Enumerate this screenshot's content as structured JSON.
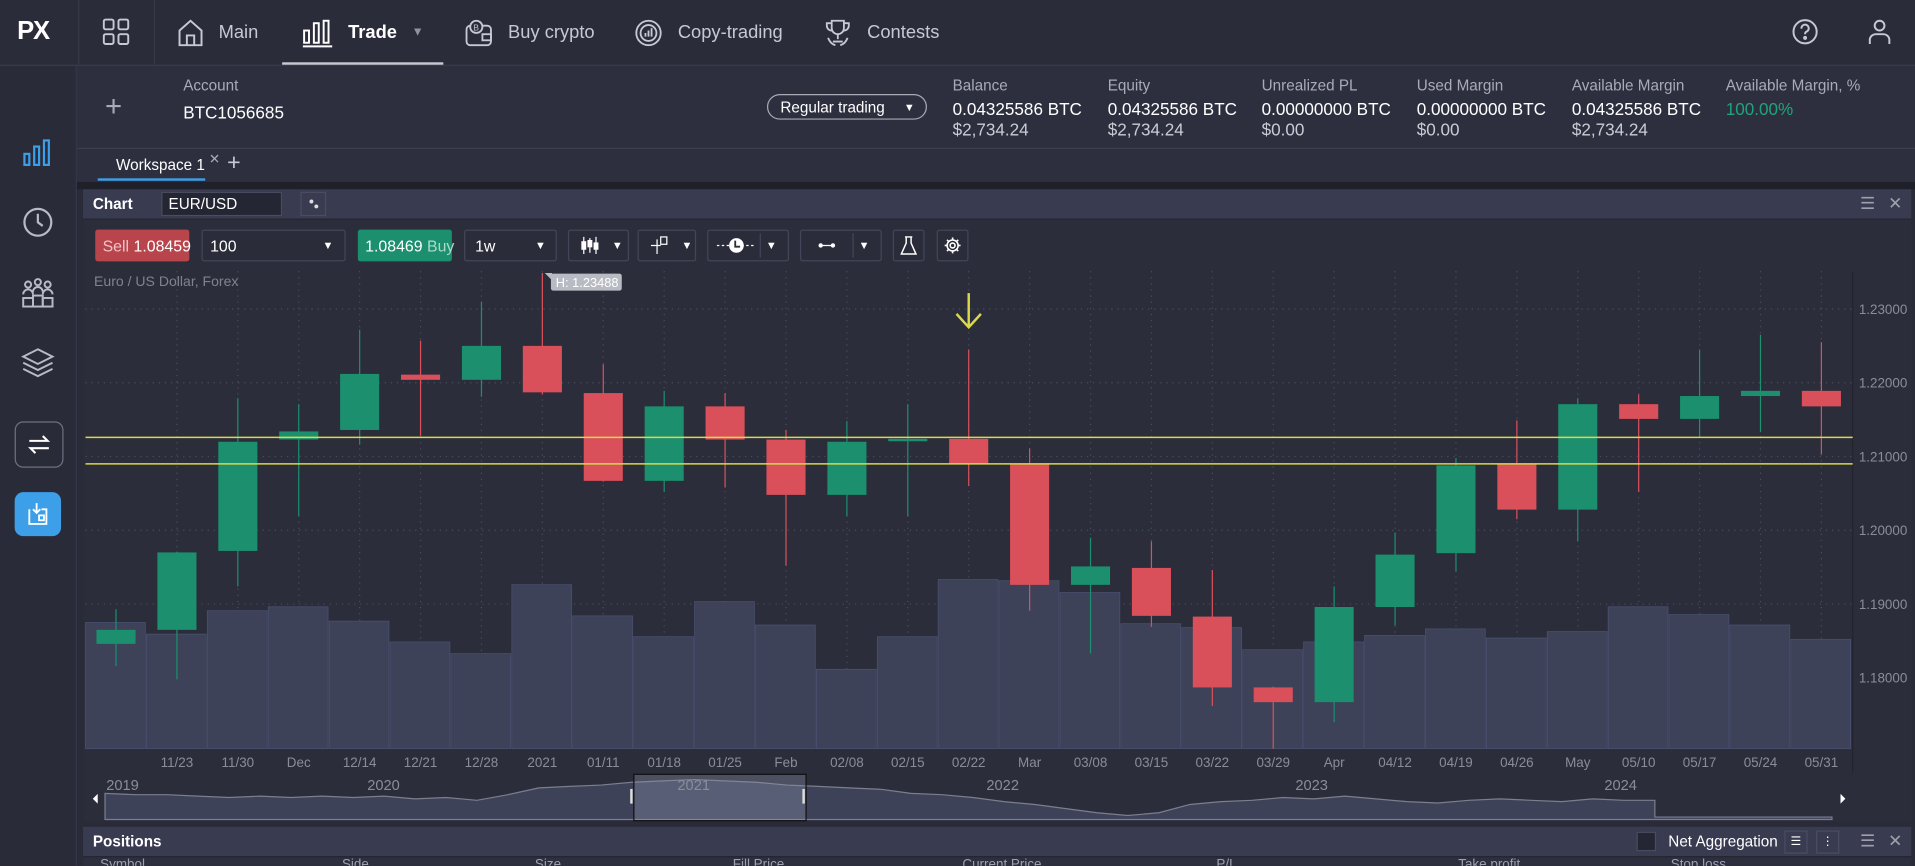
{
  "app": {
    "logo": "PX"
  },
  "nav": {
    "items": [
      {
        "label": "Main",
        "icon": "home-icon"
      },
      {
        "label": "Trade",
        "icon": "bar-chart-icon",
        "active": true
      },
      {
        "label": "Buy crypto",
        "icon": "wallet-bitcoin-icon"
      },
      {
        "label": "Copy-trading",
        "icon": "copy-trading-icon"
      },
      {
        "label": "Contests",
        "icon": "trophy-icon"
      }
    ]
  },
  "account": {
    "label": "Account",
    "id": "BTC1056685",
    "mode": "Regular trading",
    "metrics": [
      {
        "label": "Balance",
        "btc": "0.04325586 BTC",
        "usd": "$2,734.24"
      },
      {
        "label": "Equity",
        "btc": "0.04325586 BTC",
        "usd": "$2,734.24"
      },
      {
        "label": "Unrealized PL",
        "btc": "0.00000000 BTC",
        "usd": "$0.00"
      },
      {
        "label": "Used Margin",
        "btc": "0.00000000 BTC",
        "usd": "$0.00"
      },
      {
        "label": "Available Margin",
        "btc": "0.04325586 BTC",
        "usd": "$2,734.24"
      },
      {
        "label": "Available Margin, %",
        "btc": "100.00%",
        "usd": ""
      }
    ]
  },
  "workspace": {
    "tab": "Workspace 1"
  },
  "chart_panel": {
    "title": "Chart",
    "symbol": "EUR/USD",
    "sell_label": "Sell",
    "sell_price": "1.08459",
    "quantity": "100",
    "buy_price": "1.08469",
    "buy_label": "Buy",
    "timeframe": "1w",
    "instrument_desc": "Euro / US Dollar, Forex",
    "high_marker": "H: 1.23488"
  },
  "colors": {
    "up": "#1b8f6e",
    "down": "#d9505a",
    "level_line": "#d9d94a",
    "accent": "#3d9fe8",
    "positive_text": "#1fa37a"
  },
  "chart_data": {
    "type": "candlestick",
    "title": "",
    "ylim": [
      1.1675,
      1.2365
    ],
    "yticks": [
      "1.23000",
      "1.22000",
      "1.21000",
      "1.20000",
      "1.19000",
      "1.18000"
    ],
    "ytick_values": [
      1.23,
      1.22,
      1.21,
      1.2,
      1.19,
      1.18
    ],
    "grid": true,
    "categories": [
      "",
      "11/23",
      "11/30",
      "Dec",
      "12/14",
      "12/21",
      "12/28",
      "2021",
      "01/11",
      "01/18",
      "01/25",
      "Feb",
      "02/08",
      "02/15",
      "02/22",
      "Mar",
      "03/08",
      "03/15",
      "03/22",
      "03/29",
      "Apr",
      "04/12",
      "04/19",
      "04/26",
      "May",
      "05/10",
      "05/17",
      "05/24",
      "05/31"
    ],
    "ohlc": [
      [
        1.1846,
        1.1893,
        1.1816,
        1.1865
      ],
      [
        1.1865,
        1.1971,
        1.1798,
        1.197
      ],
      [
        1.1972,
        1.2179,
        1.1924,
        1.212
      ],
      [
        1.2123,
        1.2171,
        1.2019,
        1.2134
      ],
      [
        1.2136,
        1.2272,
        1.2116,
        1.2212
      ],
      [
        1.2211,
        1.2257,
        1.2128,
        1.2204
      ],
      [
        1.2204,
        1.231,
        1.2181,
        1.225
      ],
      [
        1.225,
        1.23488,
        1.2184,
        1.2187
      ],
      [
        1.2186,
        1.2225,
        1.2066,
        1.2067
      ],
      [
        1.2067,
        1.2189,
        1.2052,
        1.2168
      ],
      [
        1.2168,
        1.2186,
        1.2058,
        1.2123
      ],
      [
        1.2123,
        1.2136,
        1.1952,
        1.2048
      ],
      [
        1.2048,
        1.2148,
        1.2019,
        1.212
      ],
      [
        1.2121,
        1.2171,
        1.2019,
        1.2124
      ],
      [
        1.2124,
        1.2245,
        1.206,
        1.209
      ],
      [
        1.209,
        1.2111,
        1.1891,
        1.1926
      ],
      [
        1.1926,
        1.199,
        1.1833,
        1.1951
      ],
      [
        1.1949,
        1.1985,
        1.1869,
        1.1884
      ],
      [
        1.1883,
        1.1946,
        1.1762,
        1.1787
      ],
      [
        1.1787,
        1.1788,
        1.1704,
        1.1767
      ],
      [
        1.1767,
        1.1924,
        1.174,
        1.1896
      ],
      [
        1.1896,
        1.1997,
        1.1871,
        1.1967
      ],
      [
        1.1969,
        1.2098,
        1.1944,
        1.2088
      ],
      [
        1.209,
        1.2149,
        1.2015,
        1.2028
      ],
      [
        1.2028,
        1.2179,
        1.1985,
        1.2171
      ],
      [
        1.2171,
        1.2184,
        1.2052,
        1.2151
      ],
      [
        1.2151,
        1.2245,
        1.2126,
        1.2182
      ],
      [
        1.2182,
        1.2265,
        1.2133,
        1.2189
      ],
      [
        1.2189,
        1.2255,
        1.2103,
        1.2168
      ]
    ],
    "volume_relative": [
      97,
      88,
      106,
      109,
      98,
      82,
      73,
      126,
      102,
      86,
      113,
      95,
      61,
      86,
      130,
      129,
      120,
      96,
      93,
      76,
      82,
      87,
      92,
      85,
      90,
      109,
      103,
      95,
      84
    ],
    "horizontal_levels": [
      1.2126,
      1.209
    ],
    "annotation_arrow_at": "02/22",
    "navigator": {
      "years": [
        "2019",
        "2020",
        "2021",
        "2022",
        "2023",
        "2024"
      ],
      "series": [
        1.13,
        1.12,
        1.12,
        1.11,
        1.1,
        1.11,
        1.1,
        1.11,
        1.1,
        1.11,
        1.09,
        1.1,
        1.08,
        1.12,
        1.17,
        1.18,
        1.19,
        1.21,
        1.22,
        1.23,
        1.22,
        1.21,
        1.19,
        1.18,
        1.17,
        1.16,
        1.13,
        1.12,
        1.1,
        1.07,
        1.05,
        1.02,
        0.99,
        0.97,
        0.99,
        1.05,
        1.07,
        1.08,
        1.1,
        1.09,
        1.11,
        1.09,
        1.07,
        1.06,
        1.08,
        1.09,
        1.08,
        1.07,
        1.09,
        1.08,
        1.08
      ],
      "window": [
        "2021",
        "2021"
      ]
    }
  },
  "positions": {
    "title": "Positions",
    "net_aggregation": "Net Aggregation",
    "columns": [
      "Symbol",
      "Side",
      "Size",
      "Fill Price",
      "Current Price",
      "P/L",
      "Take profit",
      "Stop loss"
    ]
  }
}
